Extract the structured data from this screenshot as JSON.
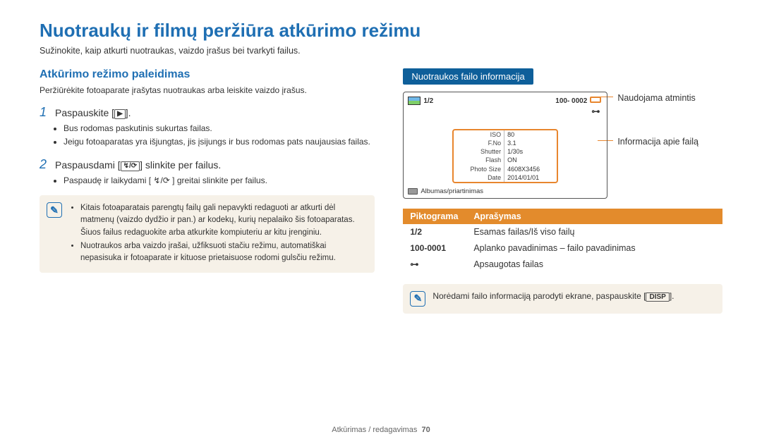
{
  "title": "Nuotraukų ir filmų peržiūra atkūrimo režimu",
  "intro": "Sužinokite, kaip atkurti nuotraukas, vaizdo įrašus bei tvarkyti failus.",
  "section": {
    "title": "Atkūrimo režimo paleidimas",
    "sub": "Peržiūrėkite fotoaparate įrašytas nuotraukas arba leiskite vaizdo įrašus."
  },
  "steps": {
    "s1": {
      "num": "1",
      "text_a": "Paspauskite [",
      "text_b": "].",
      "icon": "▶",
      "bullets": [
        "Bus rodomas paskutinis sukurtas failas.",
        "Jeigu fotoaparatas yra išjungtas, jis įsijungs ir bus rodomas pats naujausias failas."
      ]
    },
    "s2": {
      "num": "2",
      "text_a": "Paspausdami [",
      "text_b": "] slinkite per failus.",
      "icons": "↯/⟳",
      "bullets": [
        "Paspaudę ir laikydami [ ↯/⟳ ] greitai slinkite per failus."
      ]
    }
  },
  "note_left": {
    "b1": "Kitais fotoaparatais parengtų failų gali nepavykti redaguoti ar atkurti dėl matmenų (vaizdo dydžio ir pan.) ar kodekų, kurių nepalaiko šis fotoaparatas. Šiuos failus redaguokite arba atkurkite kompiuteriu ar kitu įrenginiu.",
    "b2": "Nuotraukos arba vaizdo įrašai, užfiksuoti stačiu režimu, automatiškai nepasisuka ir fotoaparate ir kituose prietaisuose rodomi gulsčiu režimu."
  },
  "right": {
    "label": "Nuotraukos failo informacija",
    "topbar_ratio": "1/2",
    "topbar_file": "100- 0002",
    "info": {
      "rows": [
        [
          "ISO",
          "80"
        ],
        [
          "F.No",
          "3.1"
        ],
        [
          "Shutter",
          "1/30s"
        ],
        [
          "Flash",
          "ON"
        ],
        [
          "Photo Size",
          "4608X3456"
        ],
        [
          "Date",
          "2014/01/01"
        ]
      ]
    },
    "foot": "Albumas/priartinimas",
    "callout1": "Naudojama atmintis",
    "callout2": "Informacija apie failą"
  },
  "legend": {
    "headers": [
      "Piktograma",
      "Aprašymas"
    ],
    "rows": [
      [
        "1/2",
        "Esamas failas/Iš viso failų"
      ],
      [
        "100-0001",
        "Aplanko pavadinimas – failo pavadinimas"
      ],
      [
        "⊶",
        "Apsaugotas failas"
      ]
    ]
  },
  "note_right": {
    "text_a": "Norėdami failo informaciją parodyti ekrane, paspauskite [",
    "disp": "DISP",
    "text_b": "]."
  },
  "footer": {
    "text": "Atkūrimas / redagavimas",
    "page": "70"
  }
}
